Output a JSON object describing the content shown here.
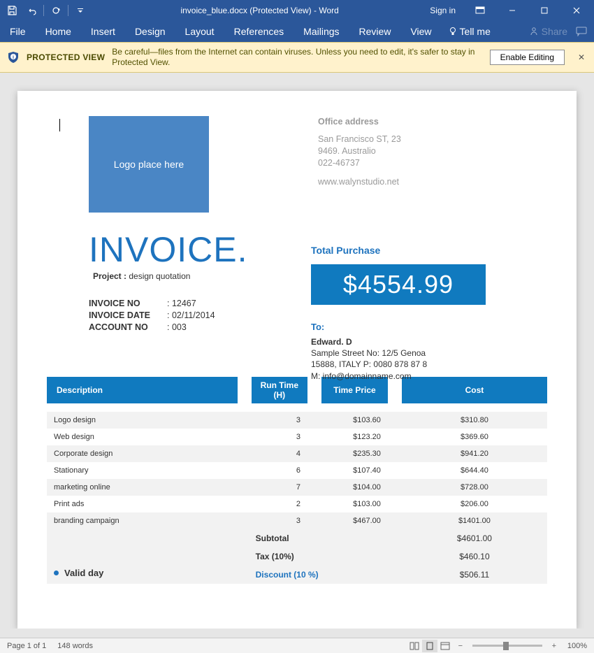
{
  "window": {
    "title": "invoice_blue.docx (Protected View) - Word",
    "signin": "Sign in"
  },
  "ribbon": {
    "tabs": [
      "File",
      "Home",
      "Insert",
      "Design",
      "Layout",
      "References",
      "Mailings",
      "Review",
      "View"
    ],
    "tellme": "Tell me",
    "share": "Share"
  },
  "protected_view": {
    "title": "PROTECTED VIEW",
    "message": "Be careful—files from the Internet can contain viruses. Unless you need to edit, it's safer to stay in Protected View.",
    "button": "Enable Editing"
  },
  "doc": {
    "logo_text": "Logo place here",
    "office": {
      "header": "Office address",
      "line1": "San Francisco ST, 23",
      "line2": "9469. Australio",
      "line3": "022-46737",
      "url": "www.walynstudio.net"
    },
    "invoice_title": "INVOICE.",
    "project_label": "Project :",
    "project_value": " design quotation",
    "purchase_label": "Total Purchase",
    "purchase_value": "$4554.99",
    "ids": [
      {
        "label": "INVOICE NO",
        "value": "12467"
      },
      {
        "label": "INVOICE DATE",
        "value": "02/11/2014"
      },
      {
        "label": "ACCOUNT NO",
        "value": "003"
      }
    ],
    "to_label": "To:",
    "to": [
      "Edward. D",
      "Sample Street No: 12/5 Genoa",
      "15888, ITALY P: 0080 878 87 8",
      "M: info@domainname.com"
    ],
    "headers": {
      "desc": "Description",
      "runtime": "Run Time (H)",
      "timeprice": "Time Price",
      "cost": "Cost"
    },
    "rows": [
      {
        "desc": "Logo design",
        "rt": "3",
        "tp": "$103.60",
        "cost": "$310.80"
      },
      {
        "desc": "Web design",
        "rt": "3",
        "tp": "$123.20",
        "cost": "$369.60"
      },
      {
        "desc": "Corporate design",
        "rt": "4",
        "tp": "$235.30",
        "cost": "$941.20"
      },
      {
        "desc": "Stationary",
        "rt": "6",
        "tp": "$107.40",
        "cost": "$644.40"
      },
      {
        "desc": "marketing online",
        "rt": "7",
        "tp": "$104.00",
        "cost": "$728.00"
      },
      {
        "desc": "Print ads",
        "rt": "2",
        "tp": "$103.00",
        "cost": "$206.00"
      },
      {
        "desc": "branding campaign",
        "rt": "3",
        "tp": "$467.00",
        "cost": "$1401.00"
      }
    ],
    "totals": [
      {
        "label": "Subtotal",
        "value": "$4601.00",
        "cls": ""
      },
      {
        "label": "Tax (10%)",
        "value": "$460.10",
        "cls": ""
      },
      {
        "label": "Discount (10 %)",
        "value": "$506.11",
        "cls": "discount"
      }
    ],
    "valid": "Valid day"
  },
  "status": {
    "page": "Page 1 of 1",
    "words": "148 words",
    "zoom": "100%"
  }
}
